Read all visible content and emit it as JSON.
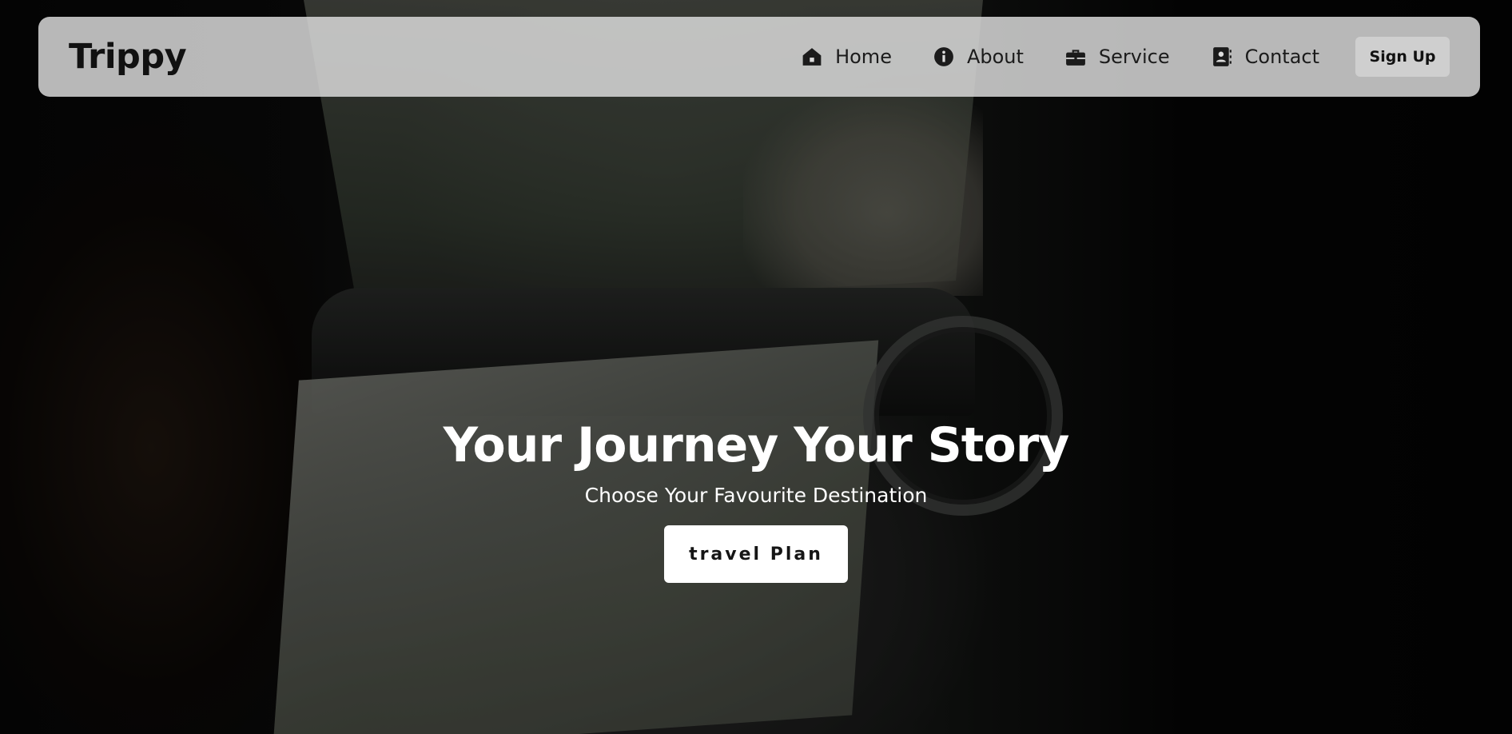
{
  "brand": {
    "name": "Trippy"
  },
  "nav": {
    "items": [
      {
        "label": "Home",
        "icon": "home-icon"
      },
      {
        "label": "About",
        "icon": "info-icon"
      },
      {
        "label": "Service",
        "icon": "briefcase-icon"
      },
      {
        "label": "Contact",
        "icon": "contact-book-icon"
      }
    ],
    "signup_label": "Sign Up"
  },
  "hero": {
    "title": "Your Journey Your Story",
    "subtitle": "Choose Your Favourite Destination",
    "cta_label": "travel Plan"
  },
  "colors": {
    "navbar_bg": "#e1e1e1",
    "text_dark": "#111111",
    "hero_text": "#ffffff",
    "button_bg": "#ffffff",
    "signup_bg": "#cfcfcf"
  }
}
